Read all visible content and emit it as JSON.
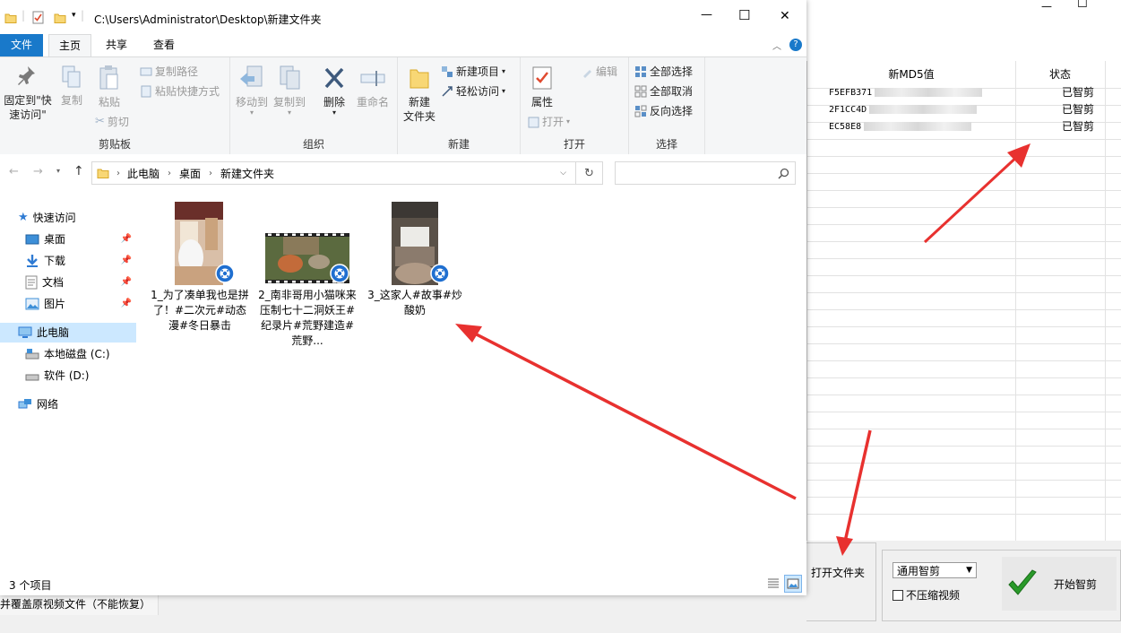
{
  "window": {
    "path": "C:\\Users\\Administrator\\Desktop\\新建文件夹",
    "controls": {
      "minimize": "—",
      "maximize": "☐",
      "close": "✕"
    }
  },
  "tabs": [
    "文件",
    "主页",
    "共享",
    "查看"
  ],
  "ribbon": {
    "clipboard": {
      "pin": "固定到\"快\n速访问\"",
      "copy": "复制",
      "paste": "粘贴",
      "copy_path": "复制路径",
      "paste_shortcut": "粘贴快捷方式",
      "cut": "剪切",
      "label": "剪贴板"
    },
    "organize": {
      "move_to": "移动到",
      "copy_to": "复制到",
      "delete": "删除",
      "rename": "重命名",
      "label": "组织"
    },
    "new": {
      "new_folder": "新建\n文件夹",
      "new_item": "新建项目",
      "easy_access": "轻松访问",
      "label": "新建"
    },
    "open": {
      "properties": "属性",
      "open": "打开",
      "edit": "编辑",
      "label": "打开"
    },
    "select": {
      "select_all": "全部选择",
      "select_none": "全部取消",
      "invert": "反向选择",
      "label": "选择"
    }
  },
  "address": {
    "crumbs": [
      "此电脑",
      "桌面",
      "新建文件夹"
    ],
    "search_placeholder": ""
  },
  "nav": {
    "quick_access": "快速访问",
    "items": [
      "桌面",
      "下载",
      "文档",
      "图片"
    ],
    "this_pc": "此电脑",
    "drives": [
      "本地磁盘 (C:)",
      "软件 (D:)"
    ],
    "network": "网络"
  },
  "files": [
    {
      "name": "1_为了凑单我也是拼了！#二次元#动态漫#冬日暴击"
    },
    {
      "name": "2_南非哥用小猫咪来压制七十二洞妖王#纪录片#荒野建造#荒野..."
    },
    {
      "name": "3_这家人#故事#炒酸奶"
    }
  ],
  "statusbar": {
    "count": "3 个项目"
  },
  "background_app": {
    "columns": {
      "md5": "新MD5值",
      "status": "状态"
    },
    "rows": [
      {
        "md5": "F5EFB371",
        "status": "已智剪"
      },
      {
        "md5": "2F1CC4D",
        "status": "已智剪"
      },
      {
        "md5": "EC58E8",
        "status": "已智剪"
      }
    ],
    "overwrite_text": "并覆盖原视频文件（不能恢复）",
    "open_folder": "打开文件夹",
    "mode_select": "通用智剪",
    "no_compress": "不压缩视频",
    "start": "开始智剪",
    "controls": {
      "minimize": "—",
      "maximize": "☐"
    }
  },
  "colors": {
    "accent": "#1979ca",
    "arrow": "#e8312f",
    "selection": "#cce8ff"
  }
}
